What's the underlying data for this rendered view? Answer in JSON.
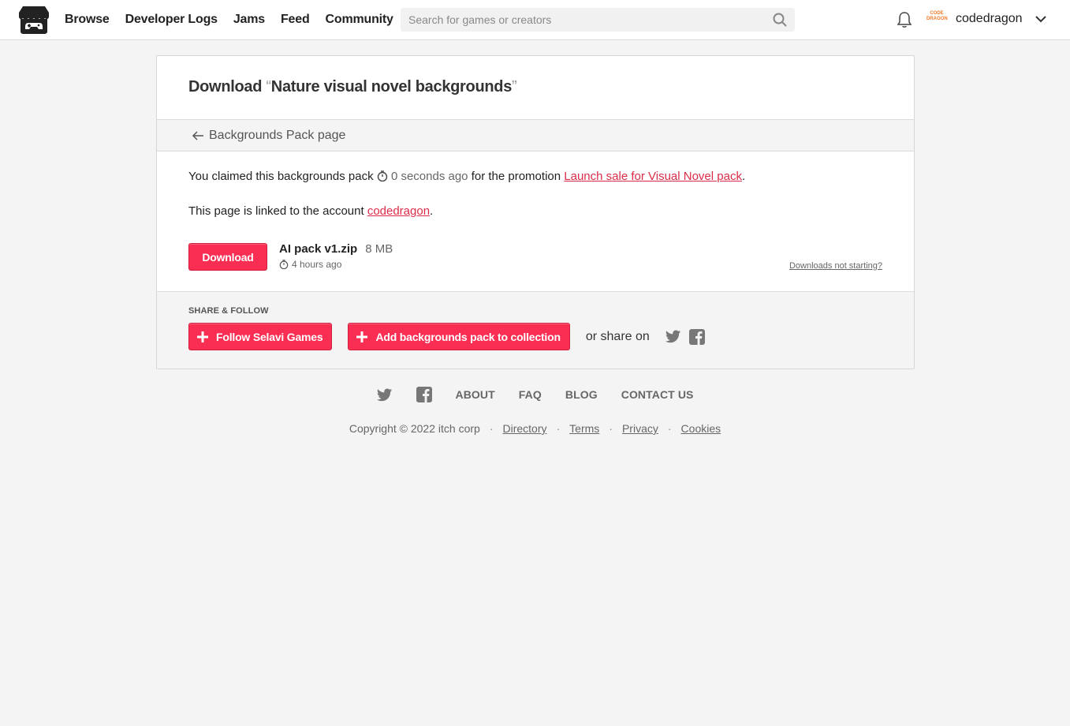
{
  "header": {
    "nav": [
      "Browse",
      "Developer Logs",
      "Jams",
      "Feed",
      "Community"
    ],
    "search_placeholder": "Search for games or creators",
    "username": "codedragon",
    "avatar_text": "CODE DRAGON"
  },
  "card": {
    "title_prefix": "Download",
    "open_quote": "“",
    "title": "Nature visual novel backgrounds",
    "close_quote": "”",
    "back_link": "Backgrounds Pack page",
    "claim_text": "You claimed this backgrounds pack",
    "claim_time": "0 seconds ago",
    "claim_for": "for the promotion",
    "promotion": "Launch sale for Visual Novel pack",
    "linked_text": "This page is linked to the account",
    "account": "codedragon",
    "download_label": "Download",
    "file_name": "AI pack v1.zip",
    "file_size": "8 MB",
    "file_time": "4 hours ago",
    "not_starting": "Downloads not starting?",
    "share_label": "SHARE & FOLLOW",
    "follow_label": "Follow Selavi Games",
    "collection_label": "Add backgrounds pack to collection",
    "or_share": "or share on"
  },
  "footer": {
    "links": [
      "ABOUT",
      "FAQ",
      "BLOG",
      "CONTACT US"
    ],
    "copyright": "Copyright © 2022 itch corp",
    "legal": [
      "Directory",
      "Terms",
      "Privacy",
      "Cookies"
    ]
  },
  "colors": {
    "accent": "#fa2e52",
    "link": "#da2c48",
    "background": "#f4f4f4"
  },
  "icons": [
    "itchio-logo-icon",
    "search-icon",
    "bell-icon",
    "chevron-down-icon",
    "arrow-left-icon",
    "clock-icon",
    "plus-icon",
    "twitter-icon",
    "facebook-icon"
  ]
}
